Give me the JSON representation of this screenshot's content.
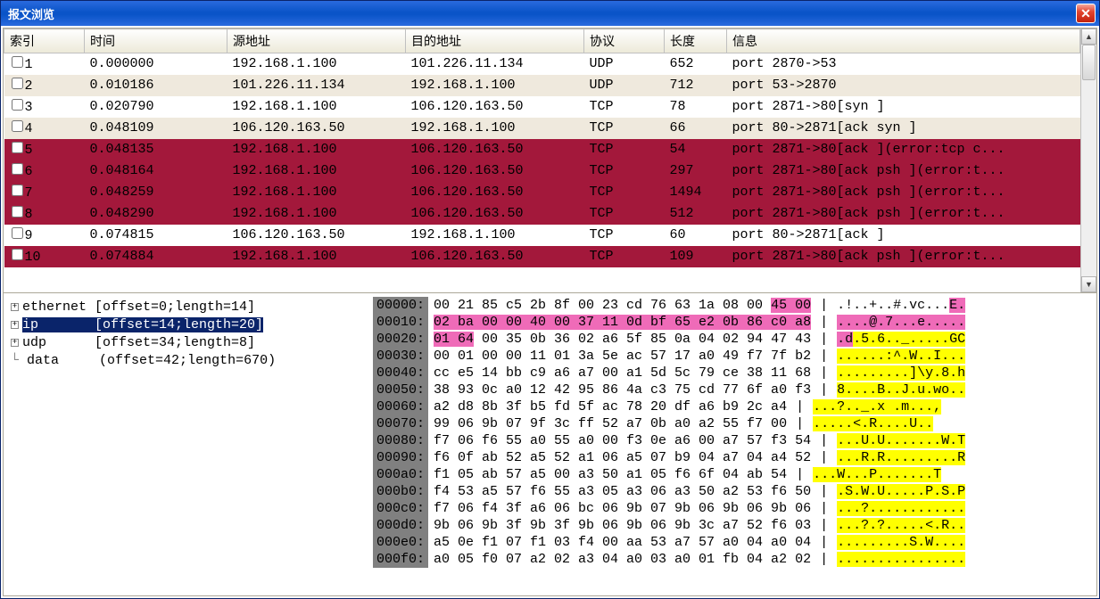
{
  "window": {
    "title": "报文浏览"
  },
  "columns": {
    "index": "索引",
    "time": "时间",
    "src": "源地址",
    "dst": "目的地址",
    "proto": "协议",
    "len": "长度",
    "info": "信息"
  },
  "packets": [
    {
      "idx": "1",
      "time": "0.000000",
      "src": "192.168.1.100",
      "dst": "101.226.11.134",
      "proto": "UDP",
      "len": "652",
      "info": "port 2870->53",
      "alt": false,
      "err": false
    },
    {
      "idx": "2",
      "time": "0.010186",
      "src": "101.226.11.134",
      "dst": "192.168.1.100",
      "proto": "UDP",
      "len": "712",
      "info": "port 53->2870",
      "alt": true,
      "err": false
    },
    {
      "idx": "3",
      "time": "0.020790",
      "src": "192.168.1.100",
      "dst": "106.120.163.50",
      "proto": "TCP",
      "len": "78",
      "info": "port 2871->80[syn ]",
      "alt": false,
      "err": false
    },
    {
      "idx": "4",
      "time": "0.048109",
      "src": "106.120.163.50",
      "dst": "192.168.1.100",
      "proto": "TCP",
      "len": "66",
      "info": "port 80->2871[ack syn ]",
      "alt": true,
      "err": false
    },
    {
      "idx": "5",
      "time": "0.048135",
      "src": "192.168.1.100",
      "dst": "106.120.163.50",
      "proto": "TCP",
      "len": "54",
      "info": "port 2871->80[ack ](error:tcp c...",
      "alt": false,
      "err": true
    },
    {
      "idx": "6",
      "time": "0.048164",
      "src": "192.168.1.100",
      "dst": "106.120.163.50",
      "proto": "TCP",
      "len": "297",
      "info": "port 2871->80[ack psh ](error:t...",
      "alt": true,
      "err": true
    },
    {
      "idx": "7",
      "time": "0.048259",
      "src": "192.168.1.100",
      "dst": "106.120.163.50",
      "proto": "TCP",
      "len": "1494",
      "info": "port 2871->80[ack psh ](error:t...",
      "alt": false,
      "err": true
    },
    {
      "idx": "8",
      "time": "0.048290",
      "src": "192.168.1.100",
      "dst": "106.120.163.50",
      "proto": "TCP",
      "len": "512",
      "info": "port 2871->80[ack psh ](error:t...",
      "alt": true,
      "err": true
    },
    {
      "idx": "9",
      "time": "0.074815",
      "src": "106.120.163.50",
      "dst": "192.168.1.100",
      "proto": "TCP",
      "len": "60",
      "info": "port 80->2871[ack ]",
      "alt": false,
      "err": false
    },
    {
      "idx": "10",
      "time": "0.074884",
      "src": "192.168.1.100",
      "dst": "106.120.163.50",
      "proto": "TCP",
      "len": "109",
      "info": "port 2871->80[ack psh ](error:t...",
      "alt": true,
      "err": true
    }
  ],
  "tree": [
    {
      "label": "ethernet",
      "detail": "[offset=0;length=14]",
      "selected": false,
      "expand": true
    },
    {
      "label": "ip",
      "detail": "[offset=14;length=20]",
      "selected": true,
      "expand": true
    },
    {
      "label": "udp",
      "detail": "[offset=34;length=8]",
      "selected": false,
      "expand": true
    },
    {
      "label": "data",
      "detail": "(offset=42;length=670)",
      "selected": false,
      "expand": false
    }
  ],
  "hex": [
    {
      "off": "00000:",
      "bytes": [
        [
          "00 21 85 c5 2b 8f 00 23 cd 76 63 1a 08 00 ",
          ""
        ],
        [
          "45 00",
          "p"
        ]
      ],
      "ascii": [
        [
          ".!..+..#.vc...",
          ""
        ],
        [
          "E.",
          "p"
        ]
      ]
    },
    {
      "off": "00010:",
      "bytes": [
        [
          "02 ba 00 00 40 00 37 11 0d bf 65 e2 0b 86 c0 a8",
          "p"
        ]
      ],
      "ascii": [
        [
          "....@.7...e.....",
          "p"
        ]
      ]
    },
    {
      "off": "00020:",
      "bytes": [
        [
          "01 64",
          "p"
        ],
        [
          " 00 35 0b 36 02 a6 5f 85 0a 04 02 94 47 43",
          ""
        ]
      ],
      "ascii": [
        [
          ".d",
          "p"
        ],
        [
          ".5.6.._.....GC",
          "y"
        ]
      ]
    },
    {
      "off": "00030:",
      "bytes": [
        [
          "00 01 00 00 11 01 3a 5e ac 57 17 a0 49 f7 7f b2",
          ""
        ]
      ],
      "ascii": [
        [
          "......:^.W..I...",
          "y"
        ]
      ]
    },
    {
      "off": "00040:",
      "bytes": [
        [
          "cc e5 14 bb c9 a6 a7 00 a1 5d 5c 79 ce 38 11 68",
          ""
        ]
      ],
      "ascii": [
        [
          ".........]\\y.8.h",
          "y"
        ]
      ]
    },
    {
      "off": "00050:",
      "bytes": [
        [
          "38 93 0c a0 12 42 95 86 4a c3 75 cd 77 6f a0 f3",
          ""
        ]
      ],
      "ascii": [
        [
          "8....B..J.u.wo..",
          "y"
        ]
      ]
    },
    {
      "off": "00060:",
      "bytes": [
        [
          "a2 d8 8b 3f b5 fd 5f ac 78 20 df a6 b9 2c a4",
          ""
        ]
      ],
      "ascii": [
        [
          "...?.._.x .m...,",
          "y"
        ]
      ]
    },
    {
      "off": "00070:",
      "bytes": [
        [
          "99 06 9b 07 9f 3c ff 52 a7 0b a0 a2 55 f7 00",
          ""
        ]
      ],
      "ascii": [
        [
          ".....<.R....U..",
          "y"
        ]
      ]
    },
    {
      "off": "00080:",
      "bytes": [
        [
          "f7 06 f6 55 a0 55 a0 00 f3 0e a6 00 a7 57 f3 54",
          ""
        ]
      ],
      "ascii": [
        [
          "...U.U.......W.T",
          "y"
        ]
      ]
    },
    {
      "off": "00090:",
      "bytes": [
        [
          "f6 0f ab 52 a5 52 a1 06 a5 07 b9 04 a7 04 a4 52",
          ""
        ]
      ],
      "ascii": [
        [
          "...R.R.........R",
          "y"
        ]
      ]
    },
    {
      "off": "000a0:",
      "bytes": [
        [
          "f1 05 ab 57 a5 00 a3 50 a1 05 f6 6f 04 ab 54",
          ""
        ]
      ],
      "ascii": [
        [
          "...W...P.......T",
          "y"
        ]
      ]
    },
    {
      "off": "000b0:",
      "bytes": [
        [
          "f4 53 a5 57 f6 55 a3 05 a3 06 a3 50 a2 53 f6 50",
          ""
        ]
      ],
      "ascii": [
        [
          ".S.W.U.....P.S.P",
          "y"
        ]
      ]
    },
    {
      "off": "000c0:",
      "bytes": [
        [
          "f7 06 f4 3f a6 06 bc 06 9b 07 9b 06 9b 06 9b 06",
          ""
        ]
      ],
      "ascii": [
        [
          "...?............",
          "y"
        ]
      ]
    },
    {
      "off": "000d0:",
      "bytes": [
        [
          "9b 06 9b 3f 9b 3f 9b 06 9b 06 9b 3c a7 52 f6 03",
          ""
        ]
      ],
      "ascii": [
        [
          "...?.?.....<.R..",
          "y"
        ]
      ]
    },
    {
      "off": "000e0:",
      "bytes": [
        [
          "a5 0e f1 07 f1 03 f4 00 aa 53 a7 57 a0 04 a0 04",
          ""
        ]
      ],
      "ascii": [
        [
          ".........S.W....",
          "y"
        ]
      ]
    },
    {
      "off": "000f0:",
      "bytes": [
        [
          "a0 05 f0 07 a2 02 a3 04 a0 03 a0 01 fb 04 a2 02",
          ""
        ]
      ],
      "ascii": [
        [
          "................",
          "y"
        ]
      ]
    }
  ]
}
